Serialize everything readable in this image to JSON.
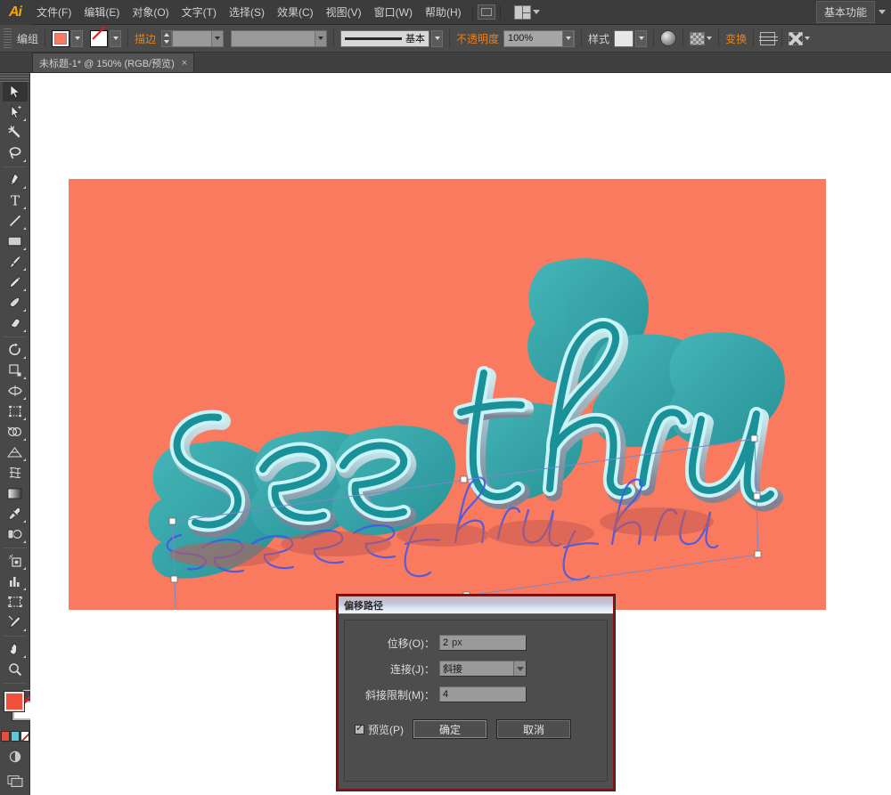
{
  "app": {
    "name": "Ai"
  },
  "menubar": {
    "items": [
      {
        "label": "文件(F)"
      },
      {
        "label": "编辑(E)"
      },
      {
        "label": "对象(O)"
      },
      {
        "label": "文字(T)"
      },
      {
        "label": "选择(S)"
      },
      {
        "label": "效果(C)"
      },
      {
        "label": "视图(V)"
      },
      {
        "label": "窗口(W)"
      },
      {
        "label": "帮助(H)"
      }
    ],
    "bridge_icon": "bridge-icon",
    "arrange_icon": "arrange-documents-icon",
    "workspace": "基本功能"
  },
  "controlbar": {
    "selection_label": "编组",
    "fill_label": "fill-swatch",
    "fill_color": "#fa7a5f",
    "stroke_label": "描边",
    "stroke_weight": "",
    "stroke_profile_label": "基本",
    "opacity_label": "不透明度",
    "opacity_value": "100%",
    "style_label": "样式",
    "transform_label": "变换",
    "recolor_icon": "recolor-artwork-icon",
    "mask_icon": "opacity-mask-icon",
    "align_icon": "align-icon",
    "options_icon": "more-options-icon"
  },
  "tabs": {
    "document": "未标题-1* @ 150% (RGB/预览)",
    "close": "×"
  },
  "toolbar": {
    "tools": [
      {
        "name": "selection-tool",
        "active": true
      },
      {
        "name": "direct-selection-tool",
        "active": false
      },
      {
        "name": "magic-wand-tool",
        "active": false
      },
      {
        "name": "lasso-tool",
        "active": false
      },
      {
        "name": "pen-tool",
        "active": false
      },
      {
        "name": "type-tool",
        "active": false
      },
      {
        "name": "line-segment-tool",
        "active": false
      },
      {
        "name": "rectangle-tool",
        "active": false
      },
      {
        "name": "paintbrush-tool",
        "active": false
      },
      {
        "name": "pencil-tool",
        "active": false
      },
      {
        "name": "blob-brush-tool",
        "active": false
      },
      {
        "name": "eraser-tool",
        "active": false
      },
      {
        "name": "rotate-tool",
        "active": false
      },
      {
        "name": "scale-tool",
        "active": false
      },
      {
        "name": "width-tool",
        "active": false
      },
      {
        "name": "free-transform-tool",
        "active": false
      },
      {
        "name": "shape-builder-tool",
        "active": false
      },
      {
        "name": "perspective-grid-tool",
        "active": false
      },
      {
        "name": "mesh-tool",
        "active": false
      },
      {
        "name": "gradient-tool",
        "active": false
      },
      {
        "name": "eyedropper-tool",
        "active": false
      },
      {
        "name": "blend-tool",
        "active": false
      },
      {
        "name": "symbol-sprayer-tool",
        "active": false
      },
      {
        "name": "column-graph-tool",
        "active": false
      },
      {
        "name": "artboard-tool",
        "active": false
      },
      {
        "name": "slice-tool",
        "active": false
      },
      {
        "name": "hand-tool",
        "active": false
      },
      {
        "name": "zoom-tool",
        "active": false
      }
    ],
    "fill_color": "#f0523c",
    "stroke_color": "none",
    "color_modes": [
      "#e84c3d",
      "#5ec8d8",
      "#ffffff"
    ],
    "gradient_icon": "gradient-icon",
    "screen_mode_icon": "screen-mode-icon"
  },
  "artwork": {
    "background_color": "#fa7a5f",
    "text": "see thru",
    "word1": "see",
    "word2": "thru",
    "face_color": "#1f9aa0",
    "extrude_color": "#2fa9ae",
    "outline_color": "#bff2f5",
    "shadow_color": "#7d7f93",
    "selection_color": "#4a5fe0",
    "selection_path_color": "#3f5ae8"
  },
  "dialog": {
    "title": "偏移路径",
    "offset_label": "位移(O)：",
    "offset_value": "2",
    "offset_unit": "px",
    "join_label": "连接(J)：",
    "join_value": "斜接",
    "miter_label": "斜接限制(M)：",
    "miter_value": "4",
    "preview_label": "预览(P)",
    "preview_checked": true,
    "ok_label": "确定",
    "cancel_label": "取消"
  }
}
